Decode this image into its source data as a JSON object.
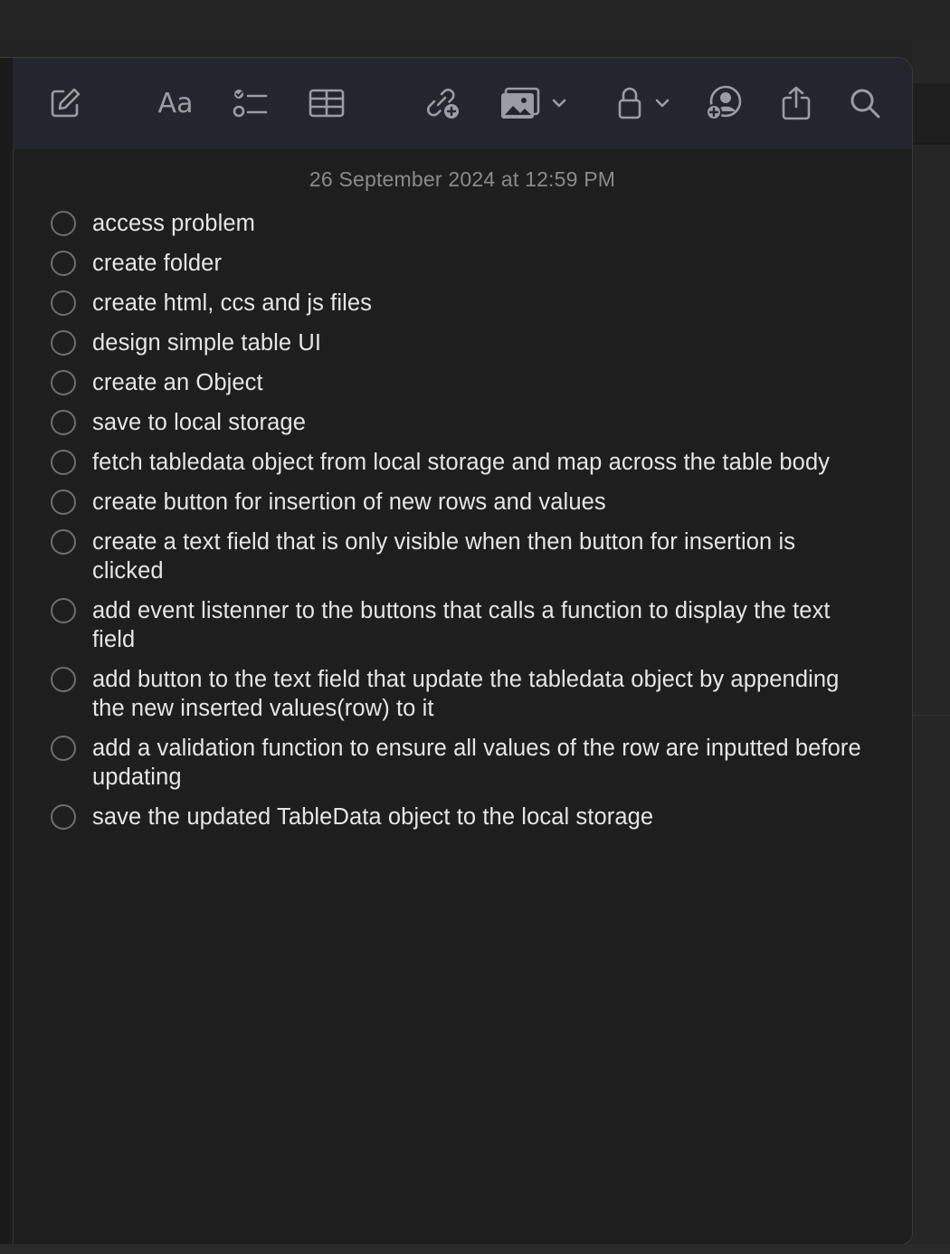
{
  "toolbar": {
    "icons": [
      {
        "name": "compose-icon"
      },
      {
        "name": "format-icon",
        "label": "Aa"
      },
      {
        "name": "checklist-icon"
      },
      {
        "name": "table-icon"
      },
      {
        "name": "link-add-icon"
      },
      {
        "name": "media-icon"
      },
      {
        "name": "lock-icon"
      },
      {
        "name": "collaborate-icon"
      },
      {
        "name": "share-icon"
      },
      {
        "name": "search-icon"
      }
    ]
  },
  "note": {
    "timestamp": "26 September 2024 at 12:59 PM",
    "items": [
      {
        "text": "access problem",
        "checked": false
      },
      {
        "text": "create folder",
        "checked": false
      },
      {
        "text": "create html, ccs and js files",
        "checked": false
      },
      {
        "text": "design simple table UI",
        "checked": false
      },
      {
        "text": "create an Object",
        "checked": false
      },
      {
        "text": "save to local storage",
        "checked": false
      },
      {
        "text": "fetch tabledata  object from local storage and map across the table body",
        "checked": false
      },
      {
        "text": "create button for insertion of new rows and values",
        "checked": false
      },
      {
        "text": "create a text field that is only visible when then button for insertion is clicked",
        "checked": false
      },
      {
        "text": "add event listenner to the buttons that calls a function to display the text field",
        "checked": false
      },
      {
        "text": "add button to the  text field that update the tabledata object by appending the new inserted values(row) to it",
        "checked": false
      },
      {
        "text": "add a validation function to ensure all values of the row are inputted before updating",
        "checked": false
      },
      {
        "text": "save the updated TableData object to the local storage",
        "checked": false
      }
    ]
  },
  "colors": {
    "background": "#1e1e1e",
    "toolbar": "#25252d",
    "icon": "#9c9ca4",
    "text": "#e6e6e6",
    "timestamp": "#8a8a8a",
    "checkbox": "#6e6e6e"
  }
}
